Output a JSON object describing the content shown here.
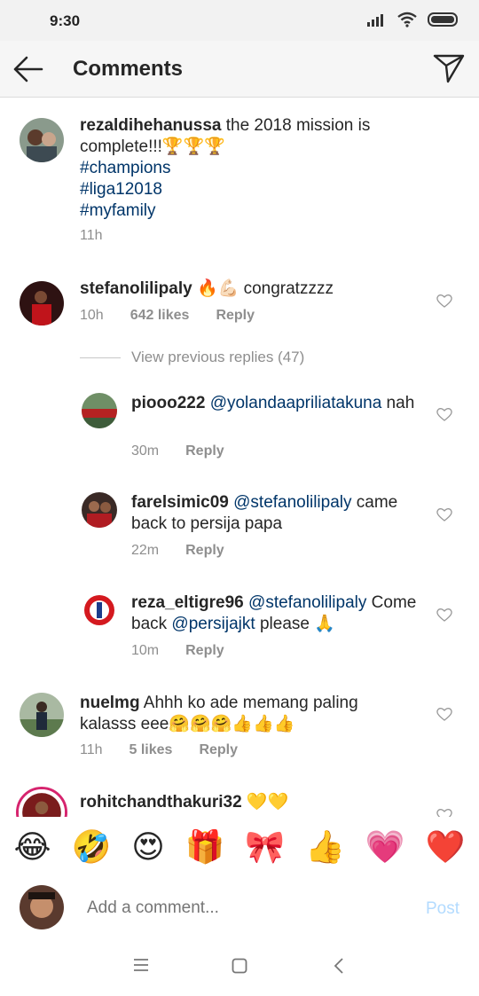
{
  "status_bar": {
    "time": "9:30",
    "icons": [
      "signal-icon",
      "wifi-icon",
      "battery-icon"
    ]
  },
  "header": {
    "title": "Comments",
    "back_icon": "arrow-left-icon",
    "send_icon": "send-icon"
  },
  "post_caption": {
    "username": "rezaldihehanussa",
    "text": " the 2018 mission is complete!!!🏆🏆🏆",
    "hashtags": [
      "#champions",
      "#liga12018",
      "#myfamily"
    ],
    "time": "11h"
  },
  "comments": [
    {
      "username": "stefanolilipaly",
      "text": " 🔥💪🏻 congratzzzz",
      "time": "10h",
      "likes": "642 likes",
      "reply": "Reply"
    },
    {
      "username": "nuelmg",
      "text": " Ahhh ko ade memang paling kalasss eee🤗🤗🤗👍👍👍",
      "time": "11h",
      "likes": "5 likes",
      "reply": "Reply"
    },
    {
      "username": "rohitchandthakuri32",
      "text": " 💛💛"
    }
  ],
  "view_previous": "View previous replies (47)",
  "replies": [
    {
      "username": "piooo222",
      "mention": "@yolandaapriliatakuna",
      "text": " nah",
      "time": "30m",
      "reply": "Reply"
    },
    {
      "username": "farelsimic09",
      "mention": "@stefanolilipaly",
      "text": " came back to persija papa",
      "time": "22m",
      "reply": "Reply"
    },
    {
      "username": "reza_eltigre96",
      "mention": "@stefanolilipaly",
      "text_before": " Come back ",
      "mention2": "@persijajkt",
      "text_after": " please 🙏",
      "time": "10m",
      "reply": "Reply"
    }
  ],
  "emoji_bar": [
    "😂",
    "🤣",
    "😍",
    "🎁",
    "🎀",
    "👍",
    "💗",
    "❤️"
  ],
  "add_comment": {
    "placeholder": "Add a comment...",
    "post_label": "Post"
  },
  "colors": {
    "link": "#003569",
    "meta": "#8e8e8e",
    "post_disabled": "#b3dbff"
  }
}
